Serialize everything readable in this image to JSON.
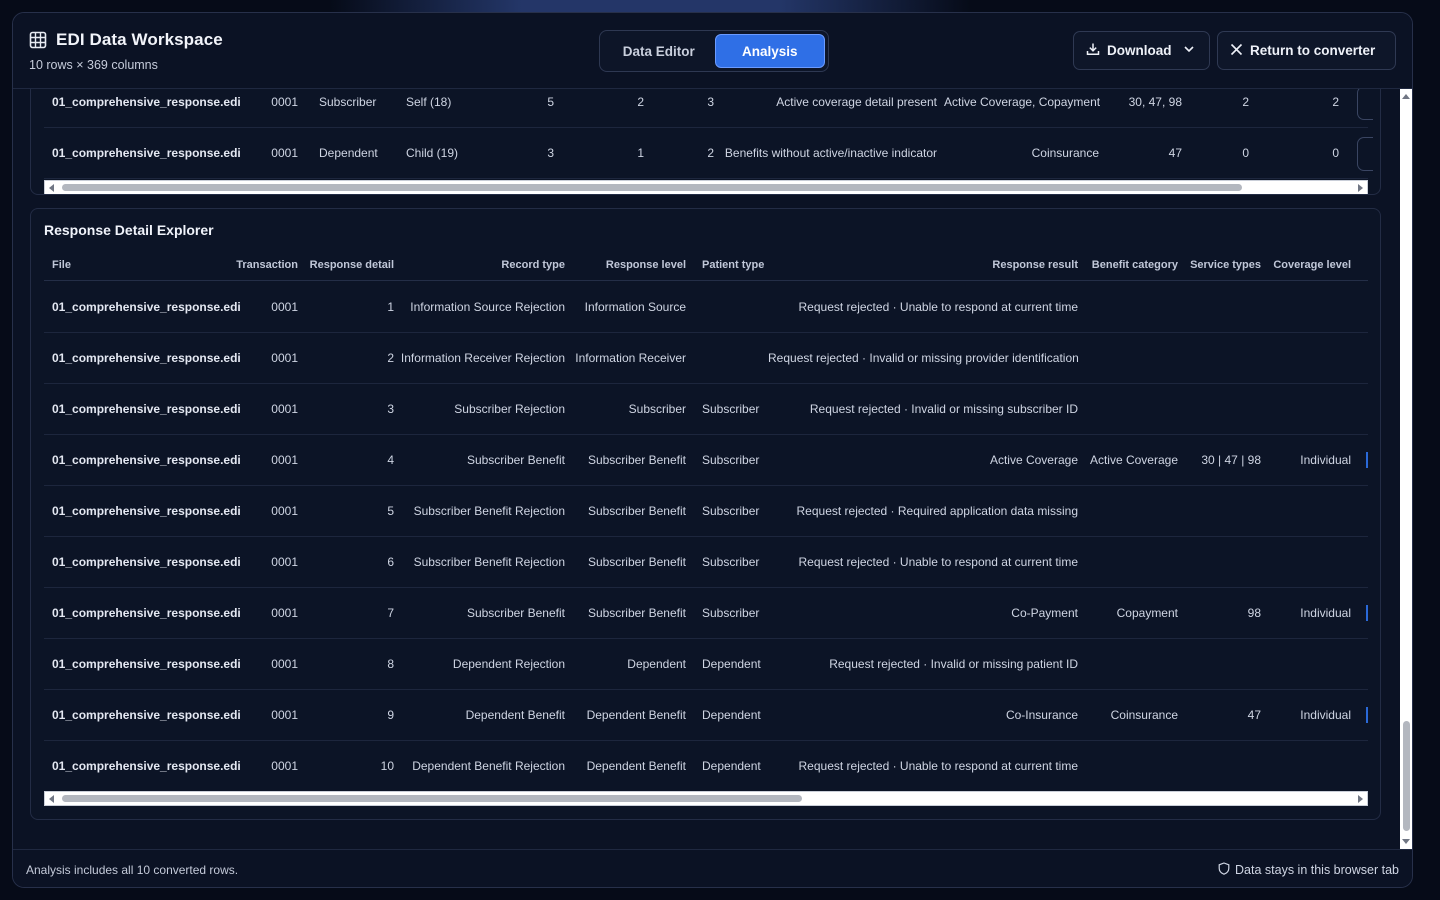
{
  "header": {
    "title": "EDI Data Workspace",
    "subtitle": "10 rows × 369 columns",
    "tabs": [
      {
        "label": "Data Editor",
        "active": false
      },
      {
        "label": "Analysis",
        "active": true
      }
    ],
    "download_label": "Download",
    "return_label": "Return to converter"
  },
  "top_table": {
    "rows": [
      [
        "01_comprehensive_response.edi",
        "0001",
        "Subscriber",
        "Self (18)",
        "5",
        "2",
        "3",
        "Active coverage detail present",
        "Active Coverage, Copayment",
        "30, 47, 98",
        "2",
        "2"
      ],
      [
        "01_comprehensive_response.edi",
        "0001",
        "Dependent",
        "Child (19)",
        "3",
        "1",
        "2",
        "Benefits without active/inactive indicator",
        "Coinsurance",
        "47",
        "0",
        "0"
      ]
    ]
  },
  "explorer": {
    "title": "Response Detail Explorer",
    "columns": [
      "File",
      "Transaction",
      "Response detail",
      "Record type",
      "Response level",
      "Patient type",
      "Response result",
      "Benefit category",
      "Service types",
      "Coverage level"
    ],
    "rows": [
      [
        "01_comprehensive_response.edi",
        "0001",
        "1",
        "Information Source Rejection",
        "Information Source",
        "",
        "Request rejected · Unable to respond at current time",
        "",
        "",
        ""
      ],
      [
        "01_comprehensive_response.edi",
        "0001",
        "2",
        "Information Receiver Rejection",
        "Information Receiver",
        "",
        "Request rejected · Invalid or missing provider identification",
        "",
        "",
        ""
      ],
      [
        "01_comprehensive_response.edi",
        "0001",
        "3",
        "Subscriber Rejection",
        "Subscriber",
        "Subscriber",
        "Request rejected · Invalid or missing subscriber ID",
        "",
        "",
        ""
      ],
      [
        "01_comprehensive_response.edi",
        "0001",
        "4",
        "Subscriber Benefit",
        "Subscriber Benefit",
        "Subscriber",
        "Active Coverage",
        "Active Coverage",
        "30 | 47 | 98",
        "Individual"
      ],
      [
        "01_comprehensive_response.edi",
        "0001",
        "5",
        "Subscriber Benefit Rejection",
        "Subscriber Benefit",
        "Subscriber",
        "Request rejected · Required application data missing",
        "",
        "",
        ""
      ],
      [
        "01_comprehensive_response.edi",
        "0001",
        "6",
        "Subscriber Benefit Rejection",
        "Subscriber Benefit",
        "Subscriber",
        "Request rejected · Unable to respond at current time",
        "",
        "",
        ""
      ],
      [
        "01_comprehensive_response.edi",
        "0001",
        "7",
        "Subscriber Benefit",
        "Subscriber Benefit",
        "Subscriber",
        "Co-Payment",
        "Copayment",
        "98",
        "Individual"
      ],
      [
        "01_comprehensive_response.edi",
        "0001",
        "8",
        "Dependent Rejection",
        "Dependent",
        "Dependent",
        "Request rejected · Invalid or missing patient ID",
        "",
        "",
        ""
      ],
      [
        "01_comprehensive_response.edi",
        "0001",
        "9",
        "Dependent Benefit",
        "Dependent Benefit",
        "Dependent",
        "Co-Insurance",
        "Coinsurance",
        "47",
        "Individual"
      ],
      [
        "01_comprehensive_response.edi",
        "0001",
        "10",
        "Dependent Benefit Rejection",
        "Dependent Benefit",
        "Dependent",
        "Request rejected · Unable to respond at current time",
        "",
        "",
        ""
      ]
    ]
  },
  "footer": {
    "left": "Analysis includes all 10 converted rows.",
    "right": "Data stays in this browser tab"
  },
  "icons": {
    "title": "table-grid-icon",
    "download": "download-icon",
    "download_caret": "chevron-down-icon",
    "return": "close-icon",
    "footer": "shield-icon"
  },
  "colors": {
    "accent": "#2f6fe6",
    "background": "#0b1224",
    "panel": "#0c1426"
  }
}
